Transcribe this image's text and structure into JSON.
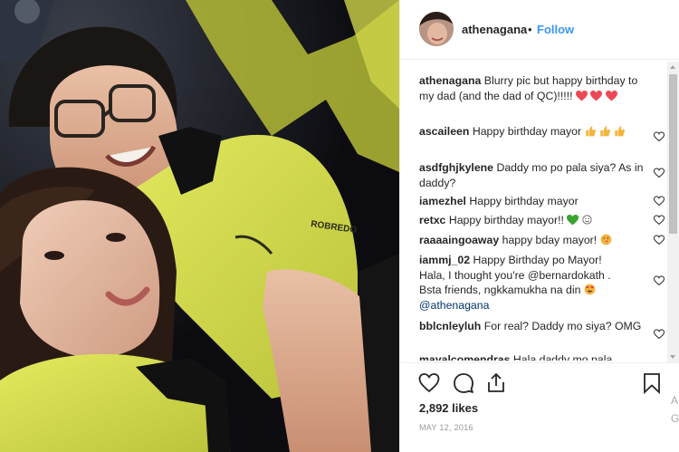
{
  "post": {
    "username": "athenagana",
    "separator": "•",
    "follow_label": "Follow"
  },
  "comments": [
    {
      "user": "athenagana",
      "text": "Blurry pic but happy birthday to my dad (and the dad of QC)!!!!!",
      "emoji": [
        "red-heart",
        "red-heart",
        "red-heart"
      ]
    },
    {
      "user": "ascaileen",
      "text": "Happy birthday mayor",
      "emoji": [
        "thumbs-up",
        "thumbs-up",
        "thumbs-up"
      ]
    },
    {
      "user": "asdfghjkylene",
      "text": "Daddy mo po pala siya? As in daddy?"
    },
    {
      "user": "iamezhel",
      "text": "Happy birthday mayor"
    },
    {
      "user": "retxc",
      "text": "Happy birthday mayor!!",
      "emoji": [
        "green-heart",
        "smiling-face"
      ]
    },
    {
      "user": "raaaaingoaway",
      "text": "happy bday mayor!",
      "emoji": [
        "kissing-face"
      ]
    },
    {
      "user": "iammj_02",
      "text_line1": "Happy Birthday po Mayor!",
      "text_line2": "Hala, I thought you're @bernardokath .",
      "text_line3": "Bsta friends, ngkkamukha na din",
      "text_line4": "@athenagana",
      "emoji": [
        "heart-eyes-face"
      ]
    },
    {
      "user": "bblcnleyluh",
      "text": "For real? Daddy mo siya? OMG"
    },
    {
      "user": "mayalcomendras",
      "text": "Hala daddy mo pala"
    }
  ],
  "photo_text": {
    "shirt_logo": "ROBREDO"
  },
  "stats": {
    "likes": "2,892 likes",
    "date": "MAY 12, 2016"
  },
  "edge_text": {
    "line1": "A",
    "line2": "G"
  },
  "colors": {
    "link_blue": "#3897f0",
    "text": "#262626",
    "muted": "#999999",
    "heart_red": "#ed4956",
    "shirt_yellow": "#d8e04a"
  },
  "icons": [
    "heart-outline-icon",
    "comment-icon",
    "share-icon",
    "bookmark-icon"
  ]
}
